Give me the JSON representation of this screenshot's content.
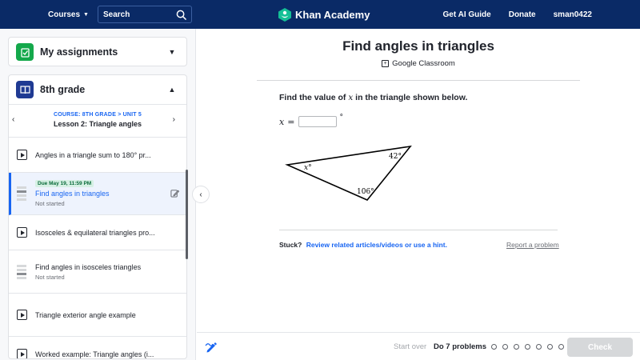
{
  "topbar": {
    "courses_label": "Courses",
    "search_placeholder": "Search",
    "logo_text": "Khan Academy",
    "get_ai_guide": "Get AI Guide",
    "donate": "Donate",
    "username": "sman0422"
  },
  "sidebar": {
    "assignments_title": "My assignments",
    "grade_title": "8th grade",
    "breadcrumb": "COURSE: 8TH GRADE > UNIT 5",
    "lesson_name": "Lesson 2: Triangle angles",
    "items": [
      {
        "title": "Angles in a triangle sum to 180° pr...",
        "type": "video"
      },
      {
        "due": "Due May 19, 11:59 PM",
        "title": "Find angles in triangles",
        "status": "Not started",
        "type": "exercise"
      },
      {
        "title": "Isosceles & equilateral triangles pro...",
        "type": "video"
      },
      {
        "title": "Find angles in isosceles triangles",
        "status": "Not started",
        "type": "exercise"
      },
      {
        "title": "Triangle exterior angle example",
        "type": "video"
      },
      {
        "title": "Worked example: Triangle angles (i...",
        "type": "video"
      }
    ]
  },
  "main": {
    "title": "Find angles in triangles",
    "google_classroom": "Google Classroom",
    "question_prefix": "Find the value of ",
    "question_var": "x",
    "question_suffix": " in the triangle shown below.",
    "answer_var": "x",
    "answer_eq": "=",
    "degree_symbol": "°",
    "triangle": {
      "angle_left": "x°",
      "angle_top": "42°",
      "angle_bottom": "106°"
    },
    "stuck_label": "Stuck?",
    "hint_link": "Review related articles/videos or use a hint.",
    "report_link": "Report a problem"
  },
  "bottombar": {
    "start_over": "Start over",
    "do_problems": "Do 7 problems",
    "problem_count": 7,
    "check_label": "Check"
  },
  "colors": {
    "nav_bg": "#0a2a66",
    "accent_blue": "#1865f2",
    "assignments_badge": "#14a84b",
    "grade_badge": "#1f3a93"
  }
}
